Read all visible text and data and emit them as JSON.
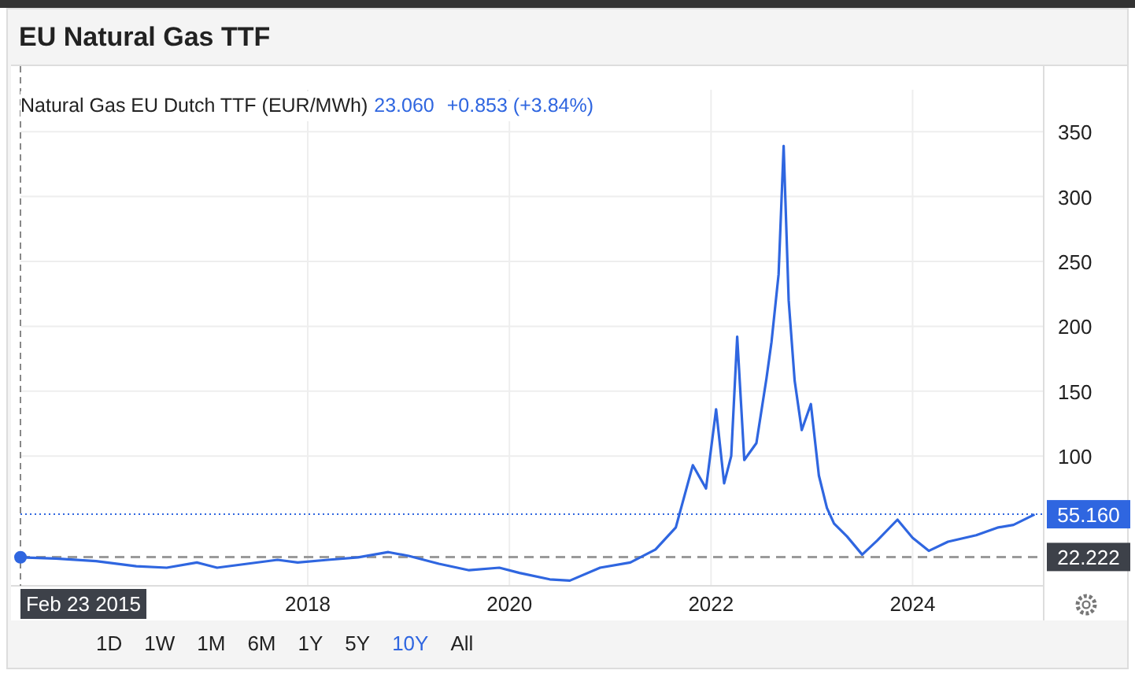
{
  "title": "EU Natural Gas TTF",
  "legend": {
    "value": "23.060",
    "change": "+0.853 (+3.84%)"
  },
  "chart_data": {
    "type": "line",
    "grid": true,
    "xlim": [
      2015.15,
      2025.3
    ],
    "ylim": [
      0,
      400
    ],
    "xticks": [
      2018,
      2020,
      2022,
      2024
    ],
    "yticks": [
      100,
      150,
      200,
      250,
      300,
      350
    ],
    "x": [
      2015.15,
      2015.5,
      2015.9,
      2016.3,
      2016.6,
      2016.9,
      2017.1,
      2017.4,
      2017.7,
      2017.9,
      2018.2,
      2018.5,
      2018.8,
      2019.0,
      2019.3,
      2019.6,
      2019.9,
      2020.1,
      2020.4,
      2020.6,
      2020.9,
      2021.2,
      2021.45,
      2021.65,
      2021.82,
      2021.95,
      2022.05,
      2022.13,
      2022.2,
      2022.26,
      2022.33,
      2022.45,
      2022.55,
      2022.6,
      2022.67,
      2022.72,
      2022.77,
      2022.83,
      2022.9,
      2022.99,
      2023.07,
      2023.15,
      2023.22,
      2023.35,
      2023.5,
      2023.65,
      2023.85,
      2024.0,
      2024.16,
      2024.35,
      2024.63,
      2024.85,
      2025.0,
      2025.21
    ],
    "series": [
      {
        "name": "Natural Gas EU Dutch TTF (EUR/MWh)",
        "color": "#2f66e0",
        "values": [
          22,
          21,
          19,
          15,
          14,
          18,
          14,
          17,
          20,
          18,
          20,
          22,
          26,
          23,
          17,
          12,
          14,
          10,
          5,
          4,
          14,
          18,
          28,
          45,
          93,
          75,
          136,
          79,
          100,
          192,
          97,
          110,
          160,
          188,
          240,
          339,
          220,
          158,
          120,
          140,
          85,
          60,
          48,
          38,
          24,
          35,
          51,
          37,
          27,
          34,
          39,
          45,
          47,
          55
        ]
      }
    ],
    "ref_lines": [
      {
        "axis": "y",
        "value": 55.16,
        "label": "55.160",
        "color": "#2f66e0"
      },
      {
        "axis": "y",
        "value": 22.222,
        "label": "22.222",
        "color": "#9a9a9a"
      }
    ]
  },
  "crosshair": {
    "date_label": "Feb 23 2015"
  },
  "ranges": [
    {
      "label": "1D",
      "selected": false
    },
    {
      "label": "1W",
      "selected": false
    },
    {
      "label": "1M",
      "selected": false
    },
    {
      "label": "6M",
      "selected": false
    },
    {
      "label": "1Y",
      "selected": false
    },
    {
      "label": "5Y",
      "selected": false
    },
    {
      "label": "10Y",
      "selected": true
    },
    {
      "label": "All",
      "selected": false
    }
  ]
}
